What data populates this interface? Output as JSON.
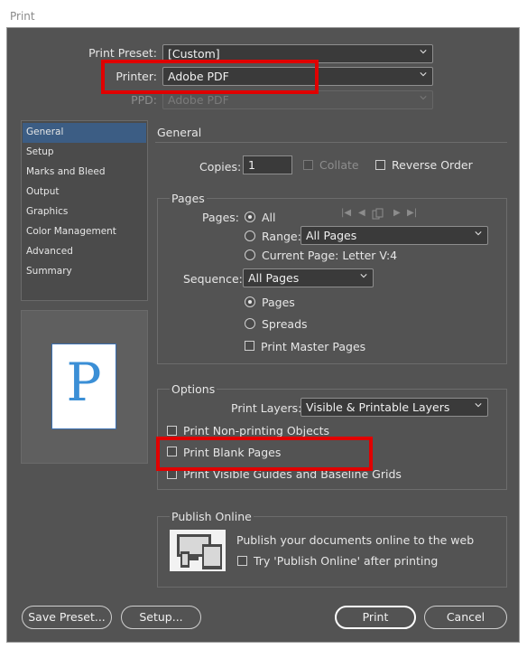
{
  "window": {
    "title": "Print"
  },
  "top": {
    "preset_label": "Print Preset:",
    "preset_value": "[Custom]",
    "printer_label": "Printer:",
    "printer_value": "Adobe PDF",
    "ppd_label": "PPD:",
    "ppd_value": "Adobe PDF"
  },
  "sidebar": {
    "items": [
      {
        "label": "General",
        "selected": true
      },
      {
        "label": "Setup"
      },
      {
        "label": "Marks and Bleed"
      },
      {
        "label": "Output"
      },
      {
        "label": "Graphics"
      },
      {
        "label": "Color Management"
      },
      {
        "label": "Advanced"
      },
      {
        "label": "Summary"
      }
    ]
  },
  "section_title": "General",
  "copies": {
    "label": "Copies:",
    "value": "1",
    "collate": "Collate",
    "reverse": "Reverse Order"
  },
  "pages": {
    "title": "Pages",
    "pages_label": "Pages:",
    "all": "All",
    "range": "Range:",
    "range_value": "All Pages",
    "current": "Current Page: Letter V:4",
    "sequence_label": "Sequence:",
    "sequence_value": "All Pages",
    "opt_pages": "Pages",
    "opt_spreads": "Spreads",
    "master": "Print Master Pages"
  },
  "options": {
    "title": "Options",
    "layers_label": "Print Layers:",
    "layers_value": "Visible & Printable Layers",
    "nonprinting": "Print Non-printing Objects",
    "blank": "Print Blank Pages",
    "guides": "Print Visible Guides and Baseline Grids"
  },
  "publish": {
    "title": "Publish Online",
    "text": "Publish your documents online to the web",
    "try": "Try 'Publish Online' after printing"
  },
  "buttons": {
    "save_preset": "Save Preset...",
    "setup": "Setup...",
    "print": "Print",
    "cancel": "Cancel"
  },
  "preview_letter": "P",
  "colors": {
    "highlight": "#e00000",
    "selection": "#3c5d84",
    "background": "#535353"
  }
}
